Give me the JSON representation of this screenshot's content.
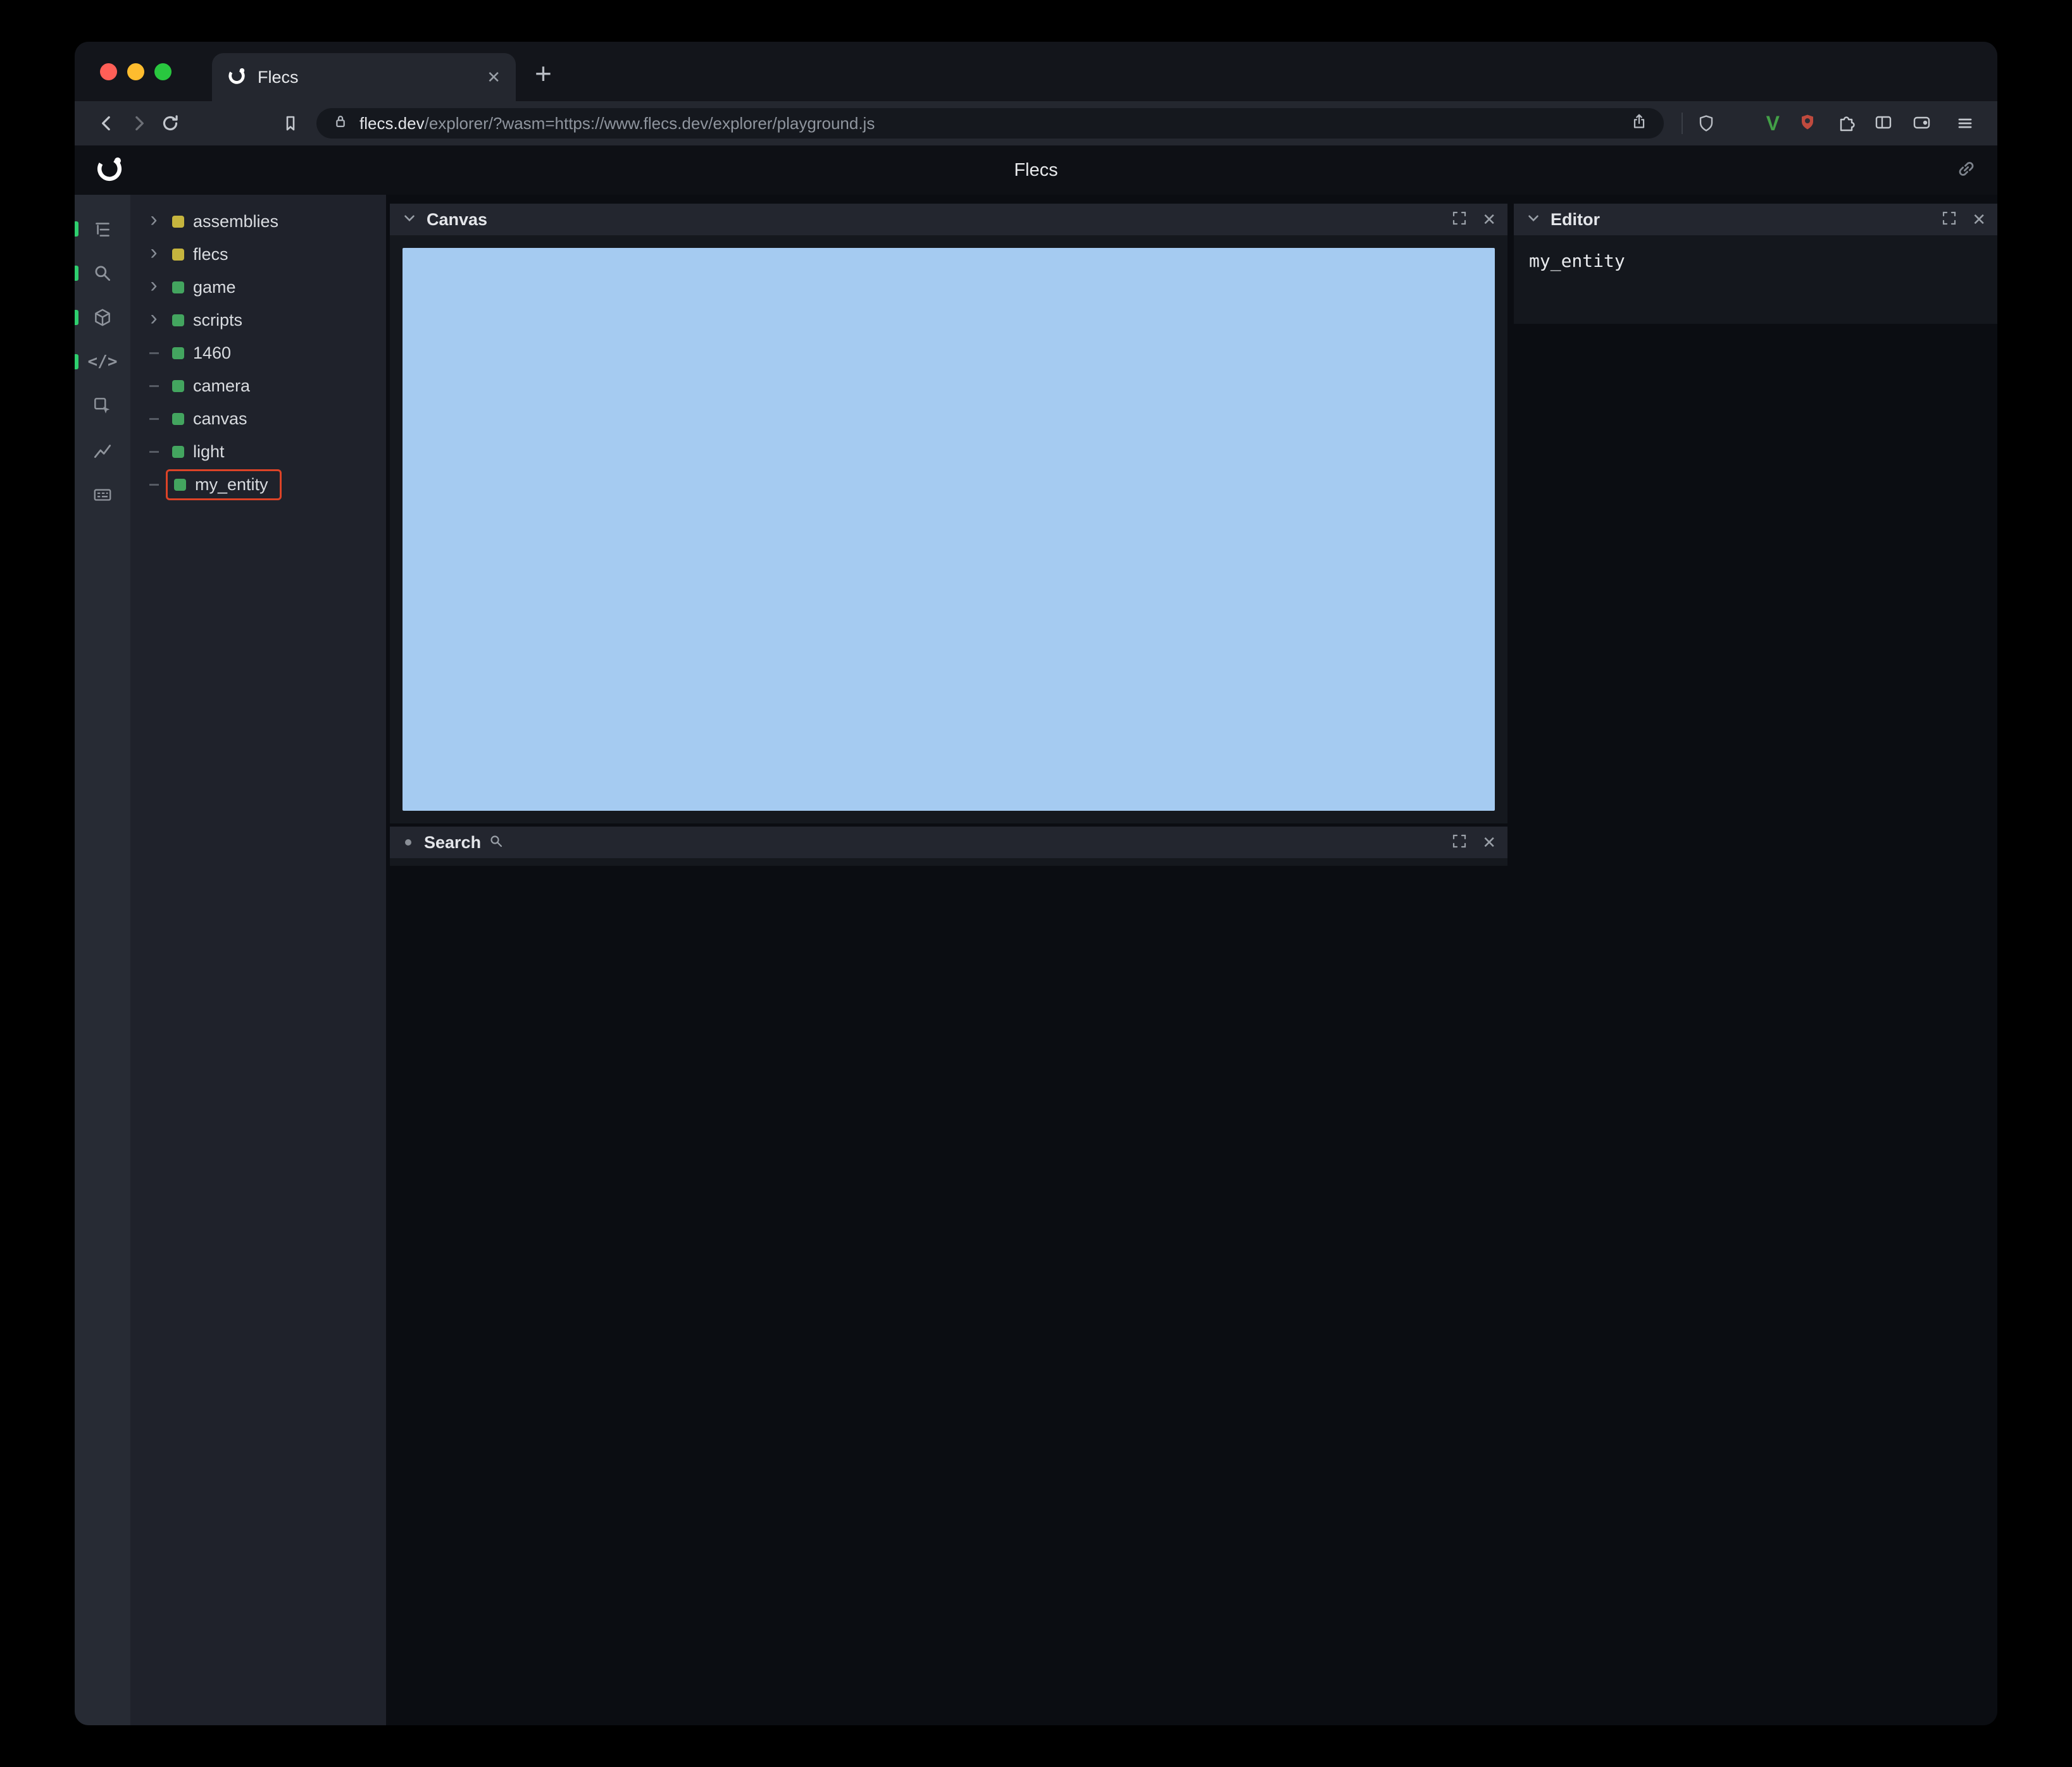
{
  "browser": {
    "tab_title": "Flecs",
    "close_tab_glyph": "✕",
    "new_tab_glyph": "+",
    "url_domain": "flecs.dev",
    "url_path": "/explorer/?wasm=https://www.flecs.dev/explorer/playground.js"
  },
  "header": {
    "title": "Flecs"
  },
  "sidebar": {
    "icons": [
      "hierarchy",
      "search",
      "cube",
      "code",
      "inspect",
      "chart",
      "console"
    ],
    "code_glyph": "</>",
    "active_indicator_color": "#2ecf6e"
  },
  "tree": {
    "items": [
      {
        "label": "assemblies",
        "dot": "yellow",
        "prefix": "chevron"
      },
      {
        "label": "flecs",
        "dot": "yellow",
        "prefix": "chevron"
      },
      {
        "label": "game",
        "dot": "green",
        "prefix": "chevron"
      },
      {
        "label": "scripts",
        "dot": "green",
        "prefix": "chevron"
      },
      {
        "label": "1460",
        "dot": "green",
        "prefix": "dash"
      },
      {
        "label": "camera",
        "dot": "green",
        "prefix": "dash"
      },
      {
        "label": "canvas",
        "dot": "green",
        "prefix": "dash"
      },
      {
        "label": "light",
        "dot": "green",
        "prefix": "dash"
      },
      {
        "label": "my_entity",
        "dot": "green",
        "prefix": "dash",
        "highlighted": true
      }
    ],
    "dot_colors": {
      "yellow": "#c6b53e",
      "green": "#43a55f"
    },
    "highlight_color": "#dc4327"
  },
  "panels": {
    "canvas": {
      "title": "Canvas",
      "surface_color": "#a5cbf1"
    },
    "search": {
      "title": "Search"
    },
    "editor": {
      "title": "Editor",
      "content": "my_entity"
    },
    "close_glyph": "✕"
  }
}
